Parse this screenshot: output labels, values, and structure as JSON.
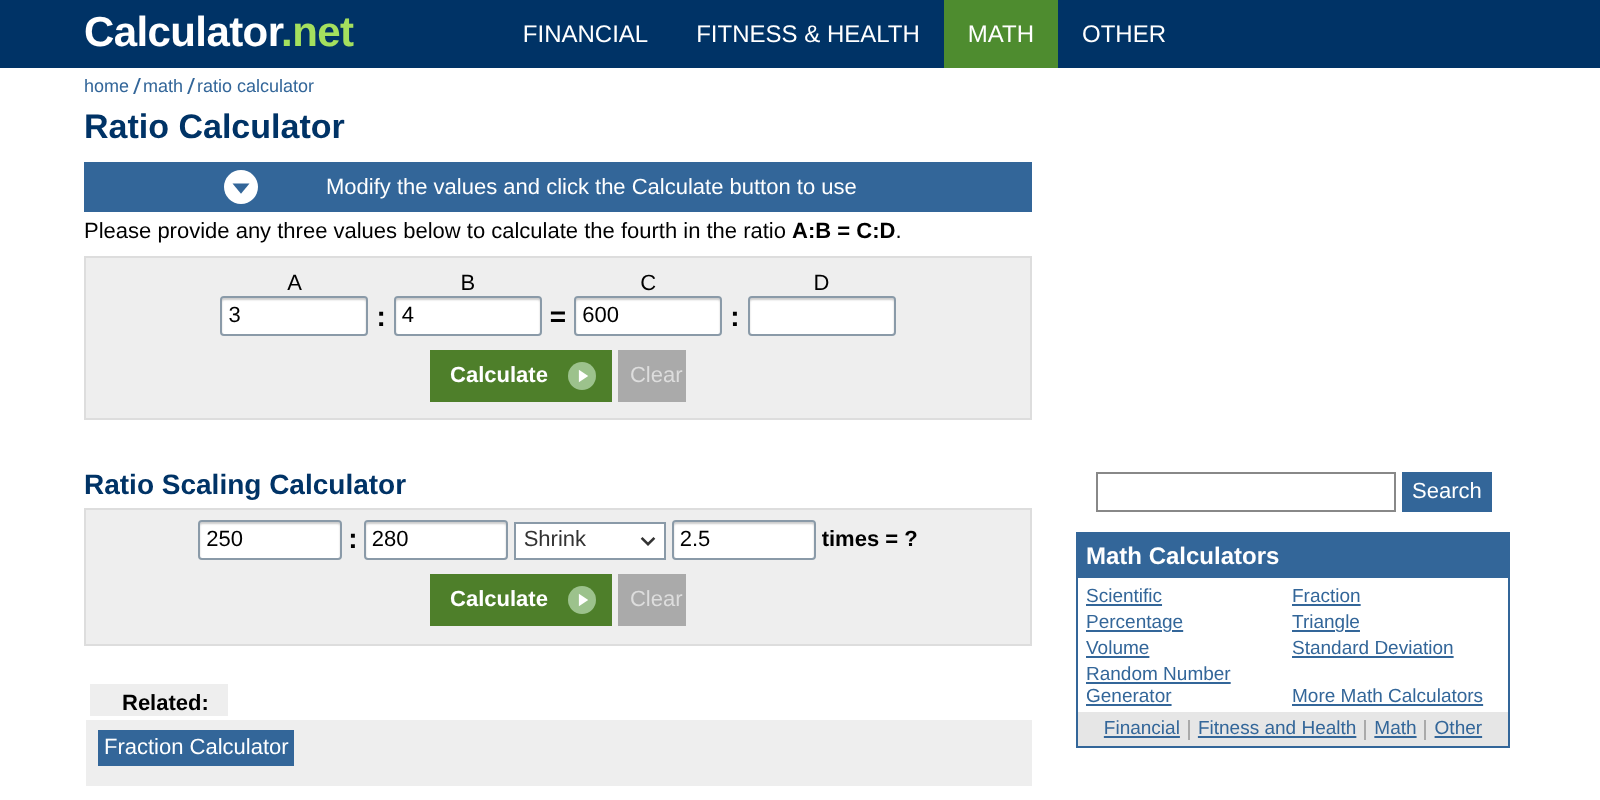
{
  "header": {
    "logo": {
      "name": "Calculator",
      "suffix": ".net"
    },
    "nav": [
      {
        "label": "FINANCIAL",
        "selected": false
      },
      {
        "label": "FITNESS & HEALTH",
        "selected": false
      },
      {
        "label": "MATH",
        "selected": true
      },
      {
        "label": "OTHER",
        "selected": false
      }
    ]
  },
  "breadcrumb": [
    "home",
    "math",
    "ratio calculator"
  ],
  "title": "Ratio Calculator",
  "banner": "Modify the values and click the Calculate button to use",
  "instruction": "Please provide any three values below to calculate the fourth in the ratio **A:B = C:D**.",
  "ratio_form": {
    "fields": [
      {
        "label": "A",
        "value": "3",
        "sep": ":"
      },
      {
        "label": "B",
        "value": "4",
        "sep": "="
      },
      {
        "label": "C",
        "value": "600",
        "sep": ":"
      },
      {
        "label": "D"
      }
    ],
    "calculate": "Calculate",
    "clear": "Clear"
  },
  "scaling": {
    "title": "Ratio Scaling Calculator",
    "a": "250",
    "sep": ":",
    "b": "280",
    "mode": "Shrink",
    "factor": "2.5",
    "suffix": "times = ?",
    "calculate": "Calculate",
    "clear": "Clear"
  },
  "related": {
    "label": "Related:",
    "links": [
      "Fraction Calculator"
    ]
  },
  "sidebar": {
    "search_button": "Search",
    "box_title": "Math Calculators",
    "links": [
      "Scientific",
      "Fraction",
      "Percentage",
      "Triangle",
      "Volume",
      "Standard Deviation",
      "Random Number Generator",
      "More Math Calculators"
    ],
    "footer_links": [
      "Financial",
      "Fitness and Health",
      "Math",
      "Other"
    ]
  }
}
